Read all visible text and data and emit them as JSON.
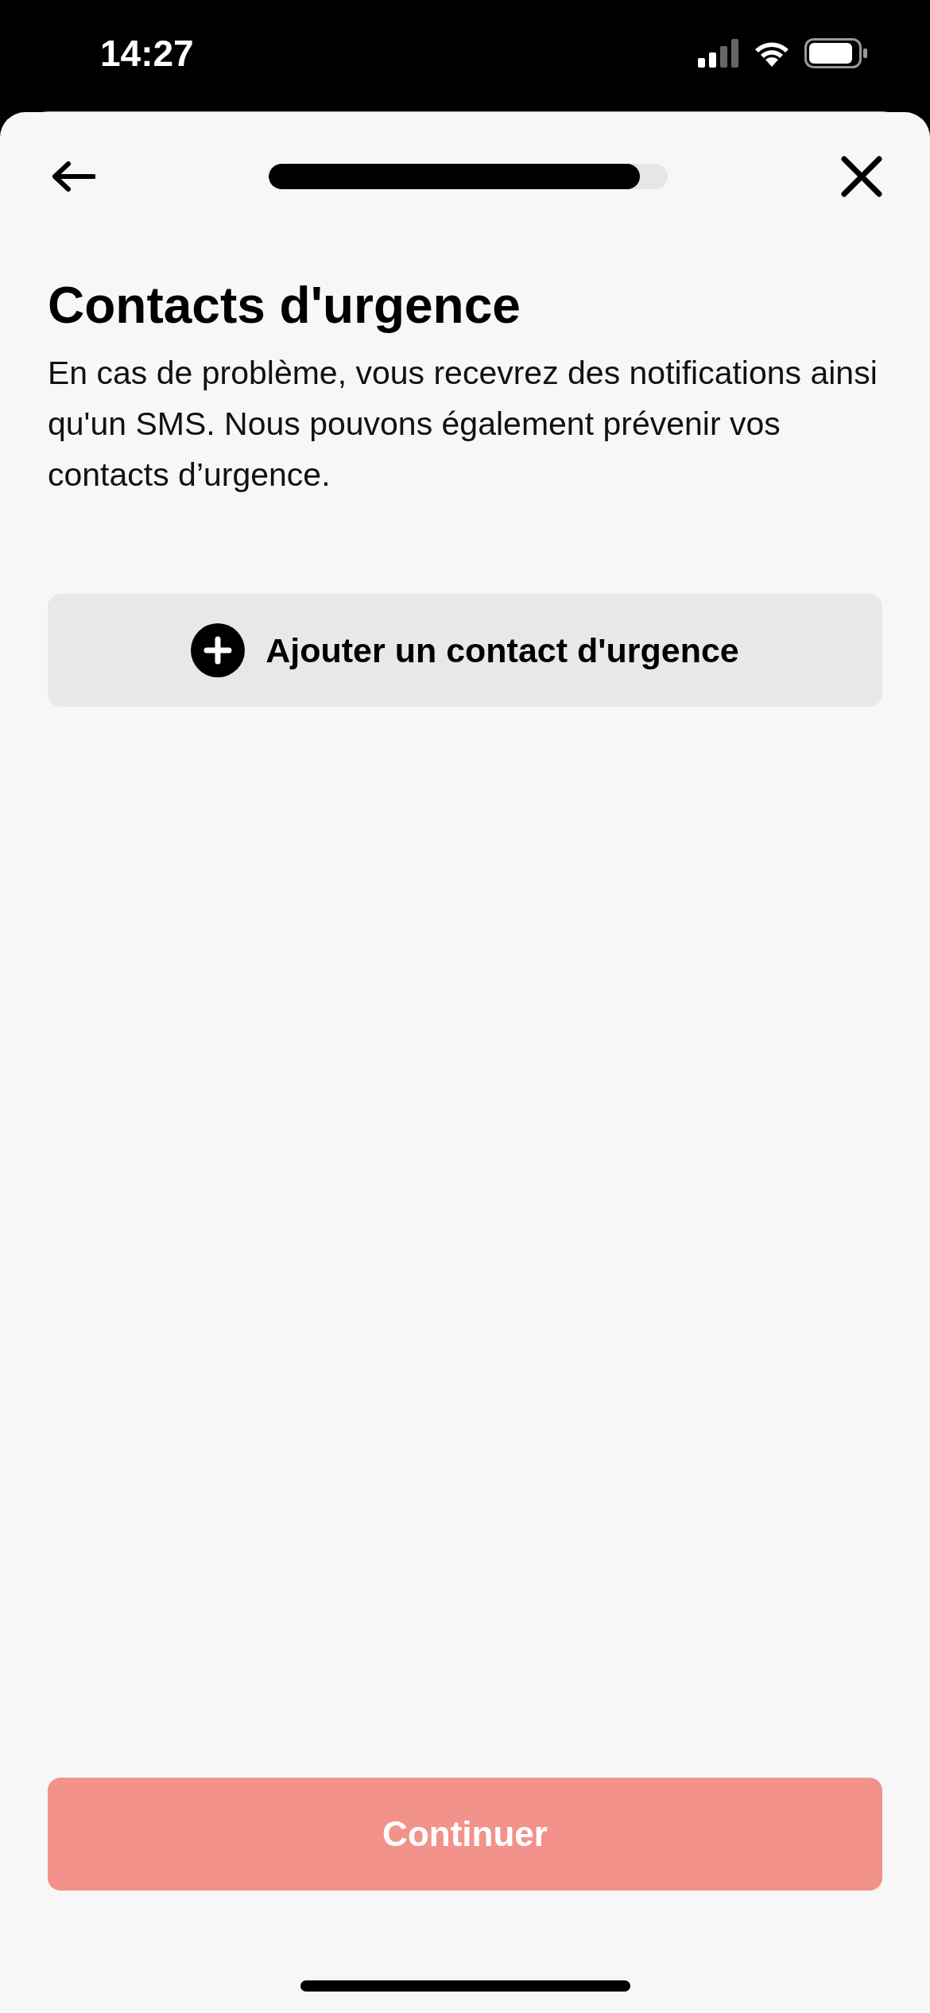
{
  "status_bar": {
    "time": "14:27"
  },
  "header": {
    "progress": {
      "level": 0.93
    }
  },
  "title": "Contacts d'urgence",
  "description": "En cas de problème, vous recevrez des notifications ainsi qu'un SMS. Nous pouvons également prévenir vos contacts d’urgence.",
  "add_button": {
    "label": "Ajouter un contact d'urgence"
  },
  "continue_button": {
    "label": "Continuer",
    "disabled": true
  }
}
